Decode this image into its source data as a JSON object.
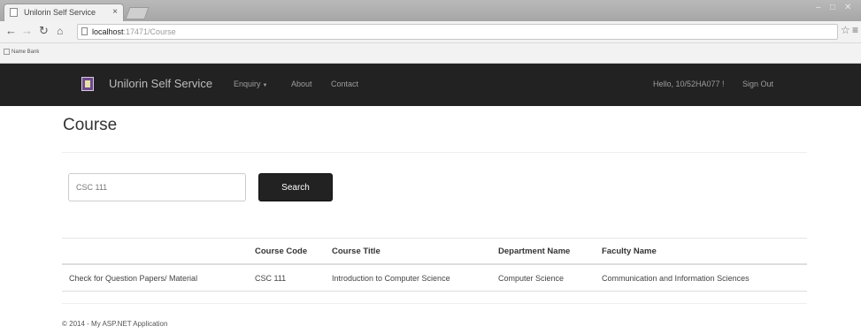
{
  "browser": {
    "tab_title": "Unilorin Self Service",
    "tab_close": "×",
    "url_host": "localhost",
    "url_path": ":17471/Course",
    "bookmark_item": "Name Bank",
    "window_controls": [
      "–",
      "□",
      "✕"
    ]
  },
  "navbar": {
    "brand": "Unilorin Self Service",
    "links": [
      "Enquiry",
      "About",
      "Contact"
    ],
    "greeting": "Hello, 10/52HA077 !",
    "sign_out": "Sign Out",
    "background": "#222222"
  },
  "page": {
    "title": "Course",
    "search": {
      "value": "CSC 111",
      "button": "Search"
    },
    "table": {
      "headers": [
        "",
        "Course Code",
        "Course Title",
        "Department Name",
        "Faculty Name"
      ],
      "rows": [
        [
          "Check for Question Papers/ Material",
          "CSC 111",
          "Introduction to Computer Science",
          "Computer Science",
          "Communication and Information Sciences"
        ]
      ]
    },
    "footer": "© 2014 - My ASP.NET Application"
  }
}
